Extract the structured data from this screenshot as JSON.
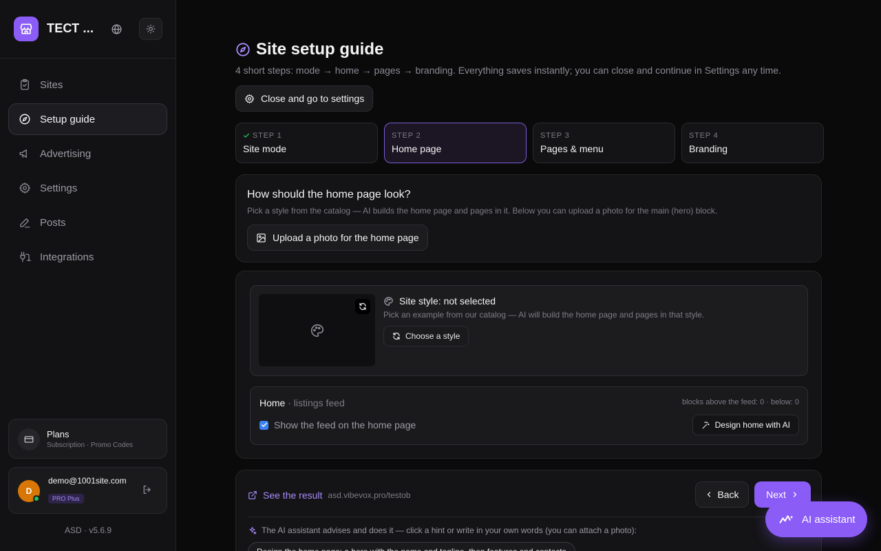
{
  "sidebar": {
    "brand": "ТЕСТ ...",
    "nav": [
      {
        "label": "Sites",
        "icon": "clipboard-check-icon"
      },
      {
        "label": "Setup guide",
        "icon": "compass-icon",
        "active": true
      },
      {
        "label": "Advertising",
        "icon": "megaphone-icon"
      },
      {
        "label": "Settings",
        "icon": "gear-icon"
      },
      {
        "label": "Posts",
        "icon": "pencil-icon"
      },
      {
        "label": "Integrations",
        "icon": "plug-icon"
      }
    ],
    "plans": {
      "title": "Plans",
      "subtitle": "Subscription · Promo Codes"
    },
    "user": {
      "initial": "D",
      "email": "demo@1001site.com",
      "badge": "PRO Plus"
    },
    "version": "ASD · v5.6.9"
  },
  "main": {
    "title": "Site setup guide",
    "subtitle": "4 short steps: mode → home → pages → branding. Everything saves instantly; you can close and continue in Settings any time.",
    "close_label": "Close and go to settings",
    "steps": [
      {
        "label": "STEP 1",
        "name": "Site mode",
        "done": true
      },
      {
        "label": "STEP 2",
        "name": "Home page",
        "active": true
      },
      {
        "label": "STEP 3",
        "name": "Pages & menu"
      },
      {
        "label": "STEP 4",
        "name": "Branding"
      }
    ],
    "question": {
      "title": "How should the home page look?",
      "subtitle": "Pick a style from the catalog — AI builds the home page and pages in it. Below you can upload a photo for the main (hero) block.",
      "upload_label": "Upload a photo for the home page"
    },
    "style": {
      "title": "Site style: not selected",
      "subtitle": "Pick an example from our catalog — AI will build the home page and pages in that style.",
      "choose_label": "Choose a style"
    },
    "home": {
      "title": "Home",
      "kind": " · listings feed",
      "blocks_info": "blocks above the feed: 0 · below: 0",
      "feed_label": "Show the feed on the home page",
      "feed_checked": true,
      "design_label": "Design home with AI"
    },
    "footer": {
      "see_label": "See the result",
      "url": "asd.vibevox.pro/testob",
      "back_label": "Back",
      "next_label": "Next",
      "ai_hint": "The AI assistant advises and does it — click a hint or write in your own words (you can attach a photo):",
      "chip": "Design the home page: a hero with the name and tagline, then features and contacts"
    }
  },
  "ai_fab": {
    "label": "AI assistant"
  },
  "colors": {
    "accent": "#8b5cf6",
    "background": "#0a0a0b",
    "sidebar": "#121214",
    "link": "#a78bfa"
  }
}
